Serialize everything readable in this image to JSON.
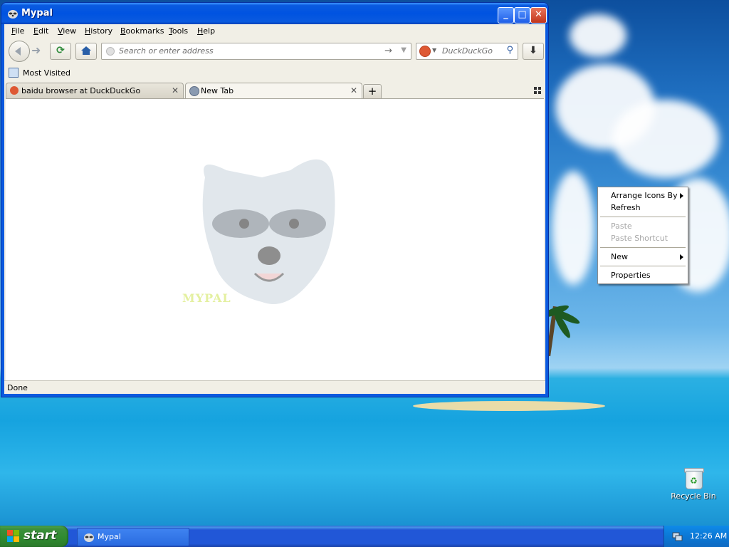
{
  "window": {
    "title": "Mypal",
    "menu": [
      "File",
      "Edit",
      "View",
      "History",
      "Bookmarks",
      "Tools",
      "Help"
    ],
    "menu_underline": [
      "F",
      "E",
      "V",
      "H",
      "B",
      "T",
      "H"
    ]
  },
  "navbar": {
    "address_placeholder": "Search or enter address",
    "search_placeholder": "DuckDuckGo"
  },
  "bookmarks": {
    "most_visited": "Most Visited"
  },
  "tabs": [
    {
      "label": "baidu browser at DuckDuckGo",
      "active": false,
      "icon": "duckduckgo-icon"
    },
    {
      "label": "New Tab",
      "active": true,
      "icon": "globe-icon"
    }
  ],
  "content": {
    "mascot_text": "MYPAL"
  },
  "status": {
    "text": "Done"
  },
  "context_menu": {
    "items": [
      {
        "label": "Arrange Icons By",
        "submenu": true,
        "disabled": false
      },
      {
        "label": "Refresh",
        "submenu": false,
        "disabled": false
      },
      {
        "label": "Paste",
        "submenu": false,
        "disabled": true
      },
      {
        "label": "Paste Shortcut",
        "submenu": false,
        "disabled": true
      },
      {
        "label": "New",
        "submenu": true,
        "disabled": false
      },
      {
        "label": "Properties",
        "submenu": false,
        "disabled": false
      }
    ]
  },
  "desktop": {
    "recycle_bin": "Recycle Bin"
  },
  "taskbar": {
    "start_label": "start",
    "task_label": "Mypal",
    "clock": "12:26 AM"
  },
  "colors": {
    "title_bar": "#0a5adf",
    "taskbar": "#2157d7",
    "start_button": "#2f8a2f",
    "tray": "#0b78d6"
  }
}
